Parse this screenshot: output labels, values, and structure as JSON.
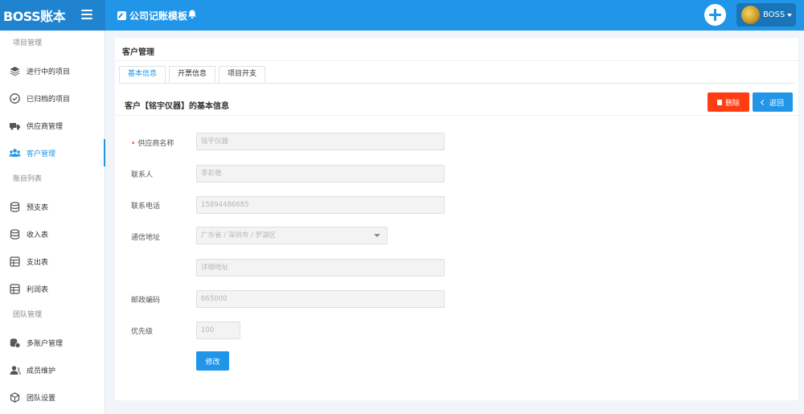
{
  "app": {
    "brand": "BOSS账本",
    "page_title": "公司记账模板"
  },
  "user": {
    "name": "BOSS"
  },
  "sidebar": {
    "sections": [
      "项目管理",
      "账目列表",
      "团队管理"
    ],
    "items": [
      {
        "label": "进行中的项目",
        "icon": "layers-icon"
      },
      {
        "label": "已归档的项目",
        "icon": "check-circle-icon"
      },
      {
        "label": "供应商管理",
        "icon": "truck-icon"
      },
      {
        "label": "客户管理",
        "icon": "users-icon",
        "active": true
      },
      {
        "label": "预支表",
        "icon": "database-icon"
      },
      {
        "label": "收入表",
        "icon": "database-icon"
      },
      {
        "label": "支出表",
        "icon": "table-icon"
      },
      {
        "label": "利润表",
        "icon": "table-icon"
      },
      {
        "label": "多账户管理",
        "icon": "coins-icon"
      },
      {
        "label": "成员维护",
        "icon": "person-icon"
      },
      {
        "label": "团队设置",
        "icon": "box-icon"
      }
    ]
  },
  "card": {
    "title": "客户管理"
  },
  "tabs": [
    "基本信息",
    "开票信息",
    "项目开支"
  ],
  "detail": {
    "title": "客户【铭宇仪器】的基本信息",
    "delete_label": "删除",
    "back_label": "返回"
  },
  "form": {
    "name_label": "供应商名称",
    "name_value": "铭宇仪器",
    "contact_label": "联系人",
    "contact_value": "李彩艳",
    "phone_label": "联系电话",
    "phone_value": "15894486685",
    "address_label": "通信地址",
    "region_value": "广东省 / 深圳市 / 罗湖区",
    "address_detail_placeholder": "详细地址",
    "zip_label": "邮政编码",
    "zip_value": "665000",
    "priority_label": "优先级",
    "priority_value": "100",
    "submit_label": "修改"
  },
  "colors": {
    "primary": "#2196e8",
    "danger": "#ff3d12",
    "sidebar_bg": "#ffffff",
    "page_bg": "#f1f4f8"
  }
}
